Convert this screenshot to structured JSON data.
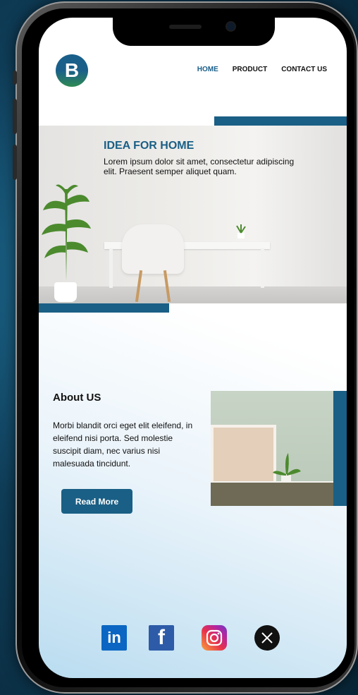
{
  "brand": {
    "logo_letter": "B"
  },
  "nav": {
    "items": [
      {
        "label": "HOME",
        "active": true
      },
      {
        "label": "PRODUCT",
        "active": false
      },
      {
        "label": "CONTACT US",
        "active": false
      }
    ]
  },
  "hero": {
    "title": "IDEA FOR HOME",
    "text": "Lorem ipsum dolor sit amet, consectetur adipiscing elit. Praesent semper aliquet quam."
  },
  "about": {
    "title": "About US",
    "text": "Morbi blandit orci eget elit eleifend, in eleifend nisi porta. Sed molestie suscipit diam, nec varius nisi malesuada tincidunt.",
    "button_label": "Read More"
  },
  "social": {
    "linkedin_text": "in",
    "facebook_text": "f",
    "icons": [
      "linkedin-icon",
      "facebook-icon",
      "instagram-icon",
      "x-icon"
    ]
  },
  "colors": {
    "accent": "#1a5f85",
    "background": "#0f3d58"
  }
}
